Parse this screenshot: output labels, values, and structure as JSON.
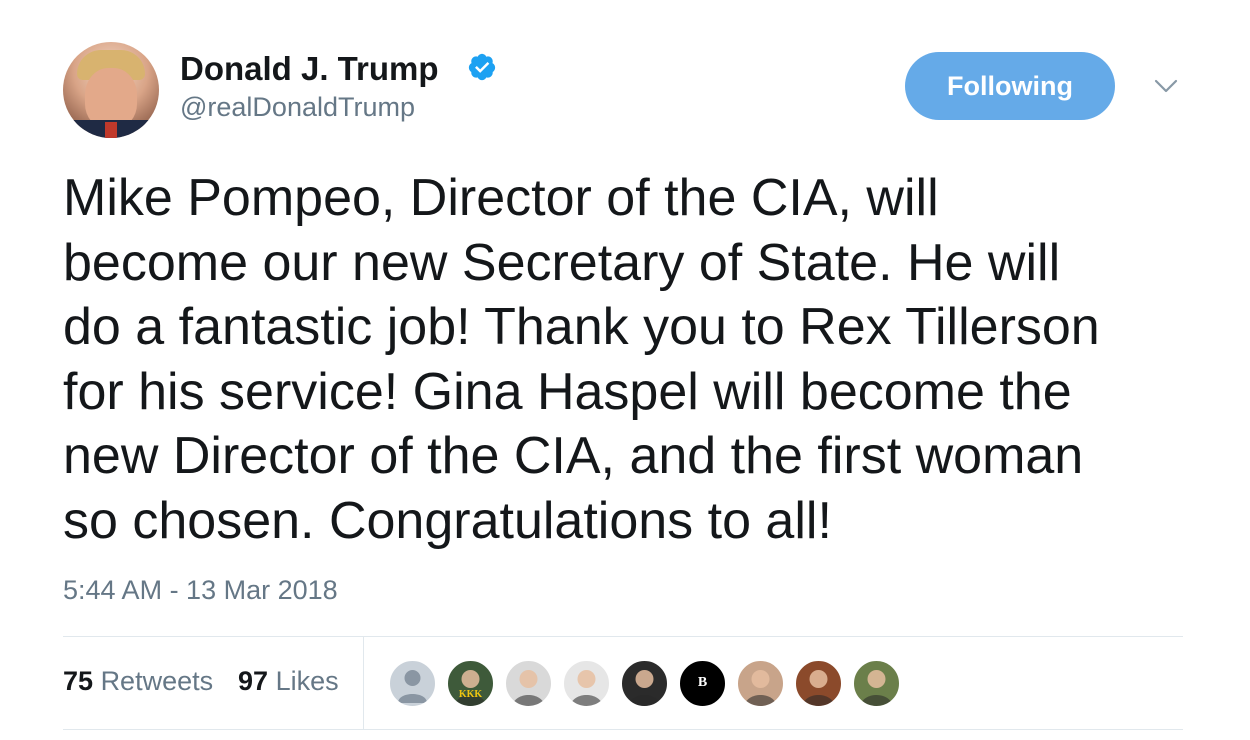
{
  "author": {
    "display_name": "Donald J. Trump",
    "handle": "@realDonaldTrump",
    "verified_icon": "verified-badge-icon",
    "avatar_icon": "profile-photo"
  },
  "follow_button": {
    "label": "Following",
    "color": "#65aae8"
  },
  "menu": {
    "icon": "chevron-down-icon"
  },
  "tweet": {
    "lines": [
      "Mike Pompeo, Director of the CIA, will",
      "become our new Secretary of State. He will",
      "do a fantastic job! Thank you to Rex Tillerson",
      "for his service! Gina Haspel will become the",
      "new Director of the CIA, and the first woman",
      "so chosen. Congratulations to all!"
    ],
    "timestamp": "5:44 AM - 13 Mar 2018"
  },
  "stats": {
    "retweets_count": "75",
    "retweets_label": "Retweets",
    "likes_count": "97",
    "likes_label": "Likes"
  },
  "likers": [
    {
      "name": "default-avatar",
      "bg": "#c9d1d9",
      "badge": ""
    },
    {
      "name": "group-photo-avatar",
      "bg": "#3e5a3a",
      "badge": "KKK"
    },
    {
      "name": "sunglasses-avatar",
      "bg": "#d9d9d9",
      "badge": ""
    },
    {
      "name": "selfie-avatar",
      "bg": "#e6e6e6",
      "badge": ""
    },
    {
      "name": "portrait-avatar",
      "bg": "#2b2b2b",
      "badge": ""
    },
    {
      "name": "logo-avatar",
      "bg": "#000000",
      "badge": "B"
    },
    {
      "name": "woman-avatar",
      "bg": "#c8a48a",
      "badge": ""
    },
    {
      "name": "sunset-avatar",
      "bg": "#8b4a2b",
      "badge": ""
    },
    {
      "name": "outdoor-avatar",
      "bg": "#6b7f4a",
      "badge": ""
    }
  ],
  "colors": {
    "text_primary": "#14171a",
    "text_secondary": "#657786",
    "divider": "#e1e8ed",
    "verified_blue": "#1da1f2"
  }
}
